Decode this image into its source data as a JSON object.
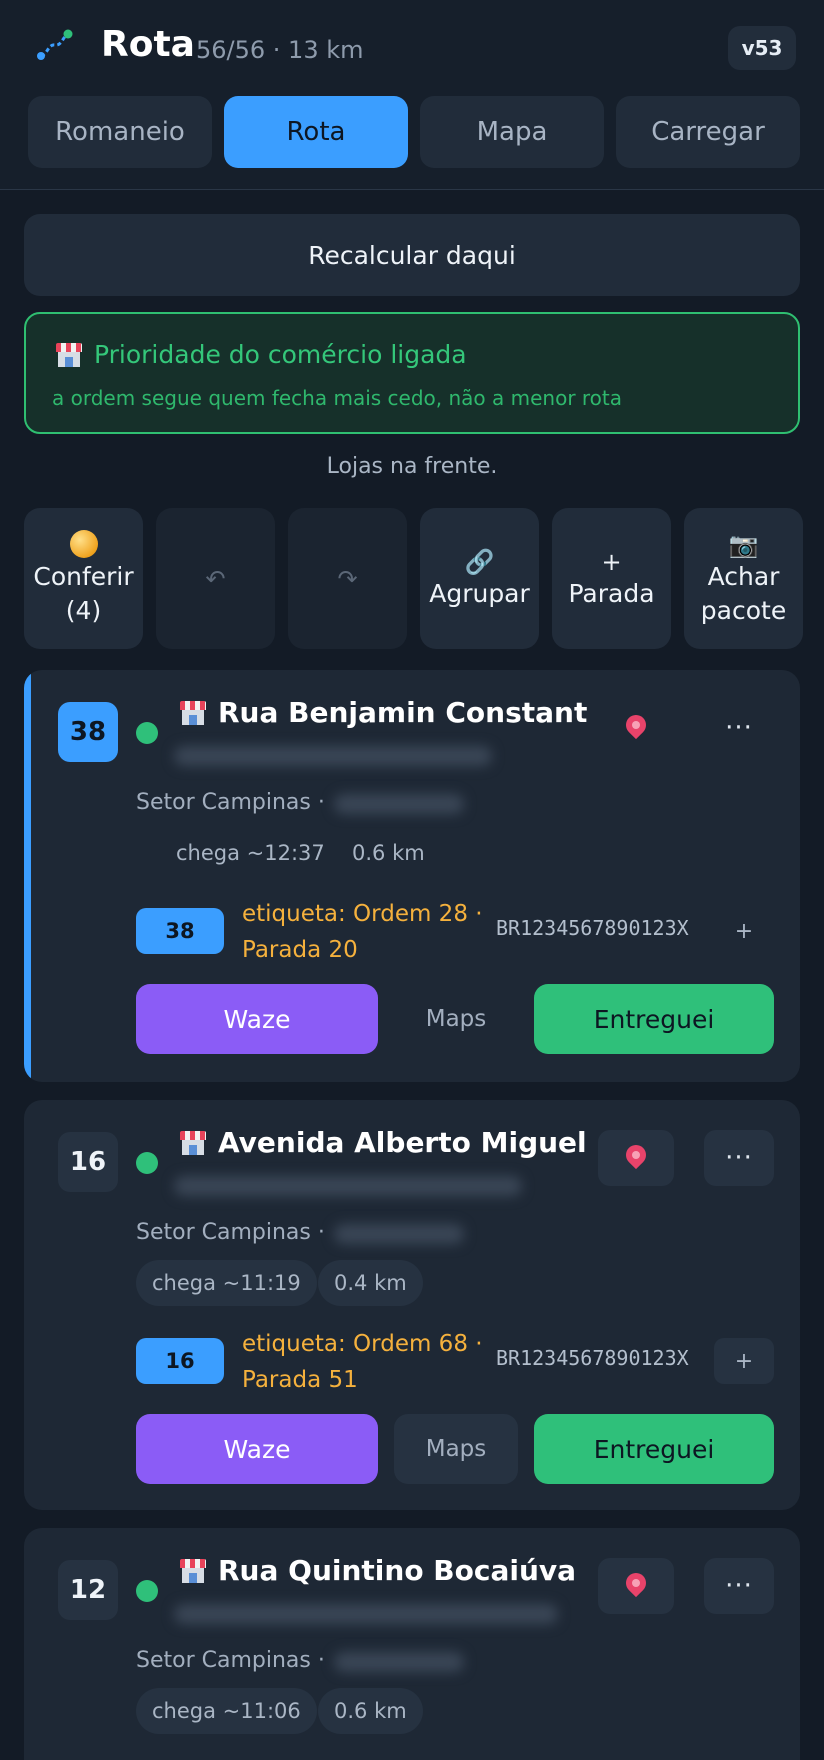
{
  "header": {
    "title": "Rota",
    "subtitle": "56/56 · 13 km",
    "version": "v53",
    "tabs": [
      {
        "label": "Romaneio",
        "active": false
      },
      {
        "label": "Rota",
        "active": true
      },
      {
        "label": "Mapa",
        "active": false
      },
      {
        "label": "Carregar",
        "active": false
      }
    ]
  },
  "recalc_label": "Recalcular daqui",
  "priority": {
    "title": "Prioridade do comércio ligada",
    "subtitle": "a ordem segue quem fecha mais cedo, não a menor rota"
  },
  "note": "Lojas na frente.",
  "actions": [
    {
      "label": "Conferir",
      "sub": "(4)",
      "icon": "coin-icon"
    },
    {
      "label": "↶",
      "icon": "undo-icon"
    },
    {
      "label": "↷",
      "icon": "redo-icon"
    },
    {
      "label": "Agrupar",
      "icon": "link-icon",
      "glyph": "🔗"
    },
    {
      "label": "Parada",
      "icon": "plus-icon",
      "glyph": "+"
    },
    {
      "label": "Achar",
      "sub": "pacote",
      "icon": "camera-icon",
      "glyph": "📷"
    }
  ],
  "stops": [
    {
      "number": "38",
      "street": "Rua Benjamin Constant",
      "sector": "Setor Campinas ·",
      "eta": "chega ~12:37",
      "distance": "0.6 km",
      "tag_number": "38",
      "label_line1": "etiqueta: Ordem 28 ·",
      "label_line2": "Parada 20",
      "code": "BR1234567890123X",
      "selected": true
    },
    {
      "number": "16",
      "street": "Avenida Alberto Miguel",
      "sector": "Setor Campinas ·",
      "eta": "chega ~11:19",
      "distance": "0.4 km",
      "tag_number": "16",
      "label_line1": "etiqueta: Ordem 68 ·",
      "label_line2": "Parada 51",
      "code": "BR1234567890123X",
      "selected": false
    },
    {
      "number": "12",
      "street": "Rua Quintino Bocaiúva",
      "sector": "Setor Campinas ·",
      "eta": "chega ~11:06",
      "distance": "0.6 km",
      "selected": false
    }
  ],
  "buttons": {
    "waze": "Waze",
    "maps": "Maps",
    "done": "Entreguei",
    "plus": "+",
    "more": "···"
  },
  "colors": {
    "accent": "#3b9eff",
    "success": "#2fc07a",
    "waze": "#8b5cf6",
    "label": "#f5b13d",
    "background": "#131b26"
  }
}
